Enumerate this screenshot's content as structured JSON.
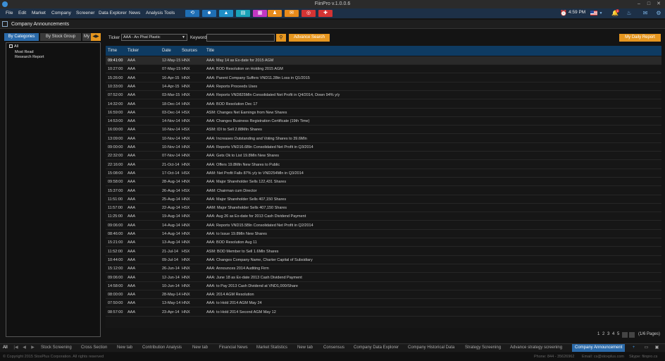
{
  "window": {
    "title": "FiinPro v.1.0.0.6"
  },
  "menu": {
    "items": [
      "File",
      "Edit",
      "Market",
      "Company",
      "Screener",
      "Data Explorer",
      "News",
      "Analysis Tools"
    ],
    "time": "4:59 PM",
    "notification_count": "1",
    "tool_colors": [
      "#1f6fb5",
      "#1f6fb5",
      "#1f8fc7",
      "#19a2b8",
      "#c237c2",
      "#e68a1b",
      "#e68a1b",
      "#d33333",
      "#d33333"
    ]
  },
  "panel": {
    "title": "Company Announcements"
  },
  "left": {
    "tabs": [
      "By Categories",
      "By Stock Group",
      "My"
    ],
    "tree": [
      "All",
      "Most Read",
      "Research Report"
    ]
  },
  "filter": {
    "ticker_label": "Ticker",
    "ticker_value": "AAA - An Phat Plastic",
    "keyword_label": "Keyword",
    "keyword_value": "",
    "advance_search": "Advance Search",
    "daily_report": "My Daily Report"
  },
  "table": {
    "columns": [
      "Time",
      "Ticker",
      "Date",
      "Sources",
      "Title"
    ],
    "rows": [
      [
        "09:41:00",
        "AAA",
        "12-May-15",
        "HNX",
        "AAA: May 14 as Ex-date for 2015 AGM"
      ],
      [
        "10:27:00",
        "AAA",
        "07-May-15",
        "HNX",
        "AAA: BOD Resolution on Holding 2015 AGM"
      ],
      [
        "15:26:00",
        "AAA",
        "16-Apr-15",
        "HNX",
        "AAA: Parent Company Suffers VND11.28tn Loss in Q1/2015"
      ],
      [
        "10:33:00",
        "AAA",
        "14-Apr-15",
        "HNX",
        "AAA: Reports Proceeds Uses"
      ],
      [
        "07:52:00",
        "AAA",
        "03-Mar-15",
        "HNX",
        "AAA: Reports VND825Mln Consolidated Net Profit in Q4/2014, Down 94% y/y"
      ],
      [
        "14:32:00",
        "AAA",
        "18-Dec-14",
        "HNX",
        "AAA: BOD Resolution Dec 17"
      ],
      [
        "16:59:00",
        "AAA",
        "03-Dec-14",
        "HSX",
        "ASM: Changes Net Earnings from New Shares"
      ],
      [
        "14:53:00",
        "AAA",
        "14-Nov-14",
        "HNX",
        "AAA: Changes Business Registration Certificate (19th Time)"
      ],
      [
        "16:00:00",
        "AAA",
        "10-Nov-14",
        "HSX",
        "ASM: IDI to Sell 2.88Mln Shares"
      ],
      [
        "13:09:00",
        "AAA",
        "10-Nov-14",
        "HNX",
        "AAA: Increases Outstanding and Voting Shares to 39.6Mln"
      ],
      [
        "09:00:00",
        "AAA",
        "10-Nov-14",
        "HNX",
        "AAA: Reports VND16.6Bln Consolidated Net Profit in Q3/2014"
      ],
      [
        "22:32:00",
        "AAA",
        "07-Nov-14",
        "HNX",
        "AAA: Gets Ok to List 19.8Mln New Shares"
      ],
      [
        "22:16:00",
        "AAA",
        "21-Oct-14",
        "HNX",
        "AAA: Offers 19.8Mln New Shares to Public"
      ],
      [
        "15:08:00",
        "AAA",
        "17-Oct-14",
        "HSX",
        "AAM: Net Profit Falls 87% y/y to VND254Mln in Q3/2014"
      ],
      [
        "09:58:00",
        "AAA",
        "28-Aug-14",
        "HNX",
        "AAA: Major Shareholder Sells 122,431 Shares"
      ],
      [
        "15:37:00",
        "AAA",
        "26-Aug-14",
        "HSX",
        "AAM: Chairman cum Director"
      ],
      [
        "11:51:00",
        "AAA",
        "25-Aug-14",
        "HNX",
        "AAA: Major Shareholder Sells 407,150 Shares"
      ],
      [
        "11:57:00",
        "AAA",
        "22-Aug-14",
        "HSX",
        "AAM: Major Shareholder Sells 407,150 Shares"
      ],
      [
        "11:25:00",
        "AAA",
        "19-Aug-14",
        "HNX",
        "AAA: Aug 26 as Ex-date for 2013 Cash Dividend Payment"
      ],
      [
        "09:06:00",
        "AAA",
        "14-Aug-14",
        "HNX",
        "AAA: Reports VND15.5Bln Consolidated Net Profit in Q2/2014"
      ],
      [
        "08:46:00",
        "AAA",
        "14-Aug-14",
        "HNX",
        "AAA: to Issue 19.8Mln New Shares"
      ],
      [
        "15:21:00",
        "AAA",
        "13-Aug-14",
        "HNX",
        "AAA: BOD Resolution Aug 11"
      ],
      [
        "11:52:00",
        "AAA",
        "21-Jul-14",
        "HSX",
        "ASM: BOD Member to Sell 1.6Mln Shares"
      ],
      [
        "10:44:00",
        "AAA",
        "09-Jul-14",
        "HNX",
        "AAA: Changes Company Name, Charter Capital of Subsidiary"
      ],
      [
        "15:12:00",
        "AAA",
        "26-Jun-14",
        "HNX",
        "AAA: Announces 2014 Auditing Firm"
      ],
      [
        "09:06:00",
        "AAA",
        "12-Jun-14",
        "HNX",
        "AAA: June 18 as Ex-date 2013 Cash Dividend Payment"
      ],
      [
        "14:58:00",
        "AAA",
        "10-Jun-14",
        "HNX",
        "AAA: to Pay 2013 Cash Dividend at VND1,000/Share"
      ],
      [
        "08:00:00",
        "AAA",
        "28-May-14",
        "HNX",
        "AAA: 2014 AGM Resolution"
      ],
      [
        "07:50:00",
        "AAA",
        "13-May-14",
        "HNX",
        "AAA: to Hold 2014 AGM May 24"
      ],
      [
        "08:57:00",
        "AAA",
        "23-Apr-14",
        "HNX",
        "AAA: to Hold 2014 Second AGM May 12"
      ]
    ]
  },
  "pager": {
    "pages": [
      "1",
      "2",
      "3",
      "4",
      "5"
    ],
    "info": "(1/6 Pages)"
  },
  "bottom_tabs": {
    "all_label": "All",
    "tabs": [
      "Stock Screening",
      "Cross Section",
      "New tab",
      "Contribution Analysis",
      "New tab",
      "Financial News",
      "Market Statistics",
      "New tab",
      "Consensus",
      "Company Data Explorer",
      "Company Historical Data",
      "Strategy Screening",
      "Advance strategy screening",
      "Company Announcement"
    ],
    "active_index": 13
  },
  "status": {
    "copyright": "© Copyright 2015 StoxPlus Corporation. All rights reserved",
    "phone": "Phone: 844 - 35626962",
    "email": "Email: cs@stoxplus.com",
    "skype": "Skype: fiinpro.cs"
  }
}
